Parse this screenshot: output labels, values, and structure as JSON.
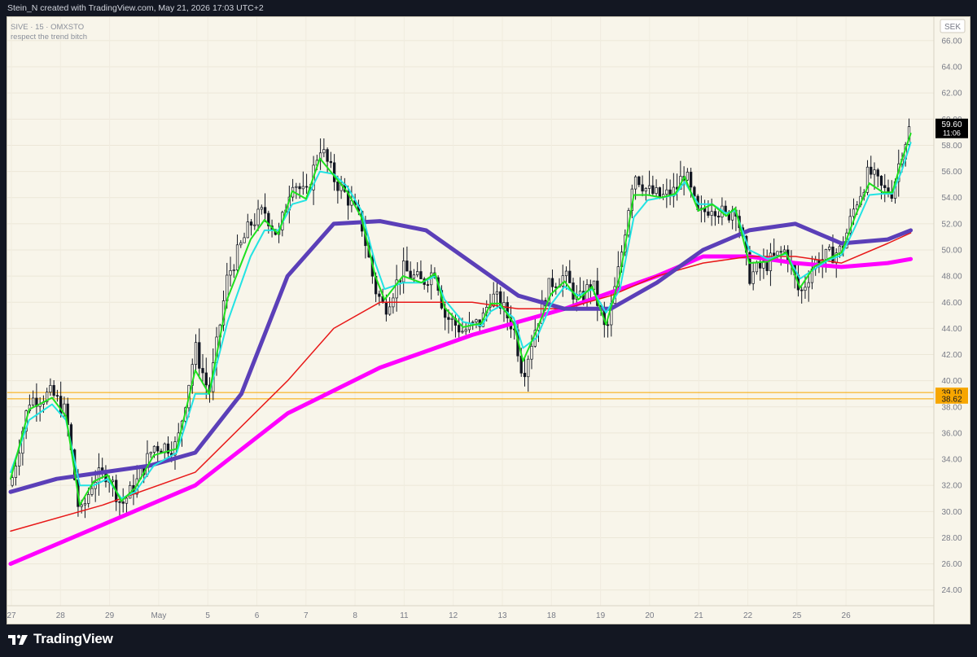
{
  "header": {
    "credit": "Stein_N created with TradingView.com, May 21, 2026 17:03 UTC+2"
  },
  "footer": {
    "brand": "TradingView"
  },
  "chart_data": {
    "type": "candlestick",
    "symbol_line": "SIVE · 15 · OMXSTO",
    "indicator_note": "respect the trend bitch",
    "currency": "SEK",
    "y_ticks": [
      "24.00",
      "26.00",
      "28.00",
      "30.00",
      "32.00",
      "34.00",
      "36.00",
      "38.00",
      "40.00",
      "42.00",
      "44.00",
      "46.00",
      "48.00",
      "50.00",
      "52.00",
      "54.00",
      "56.00",
      "58.00",
      "60.00",
      "62.00",
      "64.00",
      "66.00"
    ],
    "ylim": [
      22.8,
      67.8
    ],
    "x_ticks": [
      "27",
      "28",
      "29",
      "May",
      "5",
      "6",
      "7",
      "8",
      "11",
      "12",
      "13",
      "18",
      "19",
      "20",
      "21",
      "22",
      "25",
      "26"
    ],
    "last_price": {
      "price": "59.60",
      "countdown": "11:06",
      "value": 59.6,
      "color": "#000000"
    },
    "horizontal_levels": [
      {
        "label": "39.10",
        "value": 39.1,
        "color": "#f7a600"
      },
      {
        "label": "38.62",
        "value": 38.62,
        "color": "#f7a600"
      }
    ],
    "price_path": [
      [
        0,
        32.0
      ],
      [
        0.02,
        38.5
      ],
      [
        0.045,
        39.0
      ],
      [
        0.06,
        37.5
      ],
      [
        0.075,
        29.5
      ],
      [
        0.09,
        32.5
      ],
      [
        0.105,
        33.0
      ],
      [
        0.12,
        30.5
      ],
      [
        0.135,
        32.0
      ],
      [
        0.155,
        35.0
      ],
      [
        0.18,
        35.0
      ],
      [
        0.2,
        42.5
      ],
      [
        0.215,
        39.0
      ],
      [
        0.235,
        48.0
      ],
      [
        0.26,
        52.0
      ],
      [
        0.275,
        53.0
      ],
      [
        0.29,
        51.0
      ],
      [
        0.305,
        55.5
      ],
      [
        0.32,
        54.0
      ],
      [
        0.335,
        58.0
      ],
      [
        0.35,
        55.5
      ],
      [
        0.365,
        54.0
      ],
      [
        0.38,
        52.0
      ],
      [
        0.395,
        47.0
      ],
      [
        0.405,
        45.5
      ],
      [
        0.425,
        48.5
      ],
      [
        0.445,
        47.5
      ],
      [
        0.46,
        48.5
      ],
      [
        0.47,
        45.0
      ],
      [
        0.49,
        43.8
      ],
      [
        0.51,
        44.5
      ],
      [
        0.52,
        46.5
      ],
      [
        0.53,
        46.0
      ],
      [
        0.545,
        44.0
      ],
      [
        0.555,
        40.5
      ],
      [
        0.57,
        44.5
      ],
      [
        0.585,
        47.5
      ],
      [
        0.6,
        48.0
      ],
      [
        0.615,
        46.0
      ],
      [
        0.63,
        47.5
      ],
      [
        0.645,
        43.5
      ],
      [
        0.66,
        49.0
      ],
      [
        0.675,
        56.0
      ],
      [
        0.69,
        54.5
      ],
      [
        0.705,
        54.0
      ],
      [
        0.72,
        54.5
      ],
      [
        0.73,
        56.0
      ],
      [
        0.745,
        52.5
      ],
      [
        0.76,
        53.5
      ],
      [
        0.775,
        52.5
      ],
      [
        0.785,
        53.5
      ],
      [
        0.8,
        48.0
      ],
      [
        0.82,
        49.0
      ],
      [
        0.84,
        50.0
      ],
      [
        0.855,
        46.5
      ],
      [
        0.87,
        49.0
      ],
      [
        0.885,
        49.5
      ],
      [
        0.9,
        50.0
      ],
      [
        0.915,
        53.5
      ],
      [
        0.93,
        56.0
      ],
      [
        0.945,
        54.5
      ],
      [
        0.955,
        54.5
      ],
      [
        0.965,
        57.5
      ],
      [
        0.975,
        59.6
      ]
    ],
    "moving_averages": [
      {
        "color": "#ff00ff",
        "width": 5,
        "points": [
          [
            0,
            26.0
          ],
          [
            0.1,
            29.0
          ],
          [
            0.2,
            32.0
          ],
          [
            0.3,
            37.5
          ],
          [
            0.4,
            41.0
          ],
          [
            0.5,
            43.5
          ],
          [
            0.6,
            45.5
          ],
          [
            0.7,
            48.0
          ],
          [
            0.75,
            49.5
          ],
          [
            0.8,
            49.5
          ],
          [
            0.85,
            49.0
          ],
          [
            0.9,
            48.7
          ],
          [
            0.95,
            49.0
          ],
          [
            0.975,
            49.3
          ]
        ]
      },
      {
        "color": "#e81818",
        "width": 1.5,
        "points": [
          [
            0,
            28.5
          ],
          [
            0.1,
            30.5
          ],
          [
            0.2,
            33.0
          ],
          [
            0.3,
            40.0
          ],
          [
            0.35,
            44.0
          ],
          [
            0.4,
            46.0
          ],
          [
            0.45,
            46.0
          ],
          [
            0.5,
            46.0
          ],
          [
            0.55,
            45.5
          ],
          [
            0.6,
            45.5
          ],
          [
            0.65,
            46.5
          ],
          [
            0.7,
            48.0
          ],
          [
            0.75,
            49.0
          ],
          [
            0.8,
            49.5
          ],
          [
            0.85,
            49.5
          ],
          [
            0.9,
            49.0
          ],
          [
            0.95,
            50.5
          ],
          [
            0.975,
            51.3
          ]
        ]
      },
      {
        "color": "#5b3fb8",
        "width": 5,
        "points": [
          [
            0,
            31.5
          ],
          [
            0.05,
            32.5
          ],
          [
            0.1,
            33.0
          ],
          [
            0.15,
            33.5
          ],
          [
            0.2,
            34.5
          ],
          [
            0.25,
            39.0
          ],
          [
            0.3,
            48.0
          ],
          [
            0.35,
            52.0
          ],
          [
            0.4,
            52.2
          ],
          [
            0.45,
            51.5
          ],
          [
            0.5,
            49.0
          ],
          [
            0.55,
            46.5
          ],
          [
            0.6,
            45.5
          ],
          [
            0.65,
            45.5
          ],
          [
            0.7,
            47.5
          ],
          [
            0.75,
            50.0
          ],
          [
            0.8,
            51.5
          ],
          [
            0.85,
            52.0
          ],
          [
            0.9,
            50.5
          ],
          [
            0.95,
            50.8
          ],
          [
            0.975,
            51.5
          ]
        ]
      },
      {
        "color": "#22e3e3",
        "width": 2,
        "points": [
          [
            0,
            33.0
          ],
          [
            0.02,
            37.0
          ],
          [
            0.045,
            38.2
          ],
          [
            0.06,
            37.0
          ],
          [
            0.075,
            32.0
          ],
          [
            0.09,
            32.0
          ],
          [
            0.105,
            32.5
          ],
          [
            0.12,
            31.0
          ],
          [
            0.135,
            31.5
          ],
          [
            0.155,
            33.5
          ],
          [
            0.18,
            34.5
          ],
          [
            0.2,
            39.0
          ],
          [
            0.215,
            39.0
          ],
          [
            0.235,
            44.5
          ],
          [
            0.26,
            49.5
          ],
          [
            0.275,
            51.5
          ],
          [
            0.29,
            51.5
          ],
          [
            0.305,
            53.5
          ],
          [
            0.32,
            53.8
          ],
          [
            0.335,
            56.0
          ],
          [
            0.35,
            55.8
          ],
          [
            0.365,
            54.8
          ],
          [
            0.38,
            53.0
          ],
          [
            0.395,
            49.0
          ],
          [
            0.405,
            47.0
          ],
          [
            0.425,
            47.5
          ],
          [
            0.445,
            47.5
          ],
          [
            0.46,
            48.0
          ],
          [
            0.47,
            46.2
          ],
          [
            0.49,
            44.5
          ],
          [
            0.51,
            44.2
          ],
          [
            0.52,
            45.3
          ],
          [
            0.53,
            45.7
          ],
          [
            0.545,
            44.8
          ],
          [
            0.555,
            42.5
          ],
          [
            0.57,
            43.3
          ],
          [
            0.585,
            45.8
          ],
          [
            0.6,
            47.2
          ],
          [
            0.615,
            46.5
          ],
          [
            0.63,
            47.0
          ],
          [
            0.645,
            45.2
          ],
          [
            0.66,
            47.0
          ],
          [
            0.675,
            52.5
          ],
          [
            0.69,
            53.8
          ],
          [
            0.705,
            54.0
          ],
          [
            0.72,
            54.2
          ],
          [
            0.73,
            55.2
          ],
          [
            0.745,
            53.5
          ],
          [
            0.76,
            53.5
          ],
          [
            0.775,
            52.8
          ],
          [
            0.785,
            53.0
          ],
          [
            0.8,
            50.0
          ],
          [
            0.82,
            49.3
          ],
          [
            0.84,
            49.7
          ],
          [
            0.855,
            47.8
          ],
          [
            0.87,
            48.5
          ],
          [
            0.885,
            49.2
          ],
          [
            0.9,
            49.6
          ],
          [
            0.915,
            51.8
          ],
          [
            0.93,
            54.2
          ],
          [
            0.945,
            54.3
          ],
          [
            0.955,
            54.3
          ],
          [
            0.965,
            56.0
          ],
          [
            0.975,
            58.2
          ]
        ]
      },
      {
        "color": "#1ee01e",
        "width": 2,
        "points": [
          [
            0,
            32.5
          ],
          [
            0.02,
            37.8
          ],
          [
            0.045,
            38.7
          ],
          [
            0.06,
            37.3
          ],
          [
            0.075,
            30.5
          ],
          [
            0.09,
            32.3
          ],
          [
            0.105,
            32.8
          ],
          [
            0.12,
            30.8
          ],
          [
            0.135,
            31.8
          ],
          [
            0.155,
            34.3
          ],
          [
            0.18,
            34.8
          ],
          [
            0.2,
            40.8
          ],
          [
            0.215,
            39.0
          ],
          [
            0.235,
            46.3
          ],
          [
            0.26,
            50.8
          ],
          [
            0.275,
            52.3
          ],
          [
            0.29,
            51.2
          ],
          [
            0.305,
            54.5
          ],
          [
            0.32,
            53.9
          ],
          [
            0.335,
            57.0
          ],
          [
            0.35,
            55.7
          ],
          [
            0.365,
            54.4
          ],
          [
            0.38,
            52.5
          ],
          [
            0.395,
            48.0
          ],
          [
            0.405,
            46.2
          ],
          [
            0.425,
            48.0
          ],
          [
            0.445,
            47.5
          ],
          [
            0.46,
            48.2
          ],
          [
            0.47,
            45.6
          ],
          [
            0.49,
            44.1
          ],
          [
            0.51,
            44.4
          ],
          [
            0.52,
            45.9
          ],
          [
            0.53,
            45.9
          ],
          [
            0.545,
            44.4
          ],
          [
            0.555,
            41.5
          ],
          [
            0.57,
            43.9
          ],
          [
            0.585,
            46.6
          ],
          [
            0.6,
            47.6
          ],
          [
            0.615,
            46.2
          ],
          [
            0.63,
            47.2
          ],
          [
            0.645,
            44.3
          ],
          [
            0.66,
            48.0
          ],
          [
            0.675,
            54.2
          ],
          [
            0.69,
            54.2
          ],
          [
            0.705,
            54.0
          ],
          [
            0.72,
            54.3
          ],
          [
            0.73,
            55.6
          ],
          [
            0.745,
            53.0
          ],
          [
            0.76,
            53.5
          ],
          [
            0.775,
            52.6
          ],
          [
            0.785,
            53.2
          ],
          [
            0.8,
            49.0
          ],
          [
            0.82,
            49.1
          ],
          [
            0.84,
            49.8
          ],
          [
            0.855,
            47.1
          ],
          [
            0.87,
            48.7
          ],
          [
            0.885,
            49.3
          ],
          [
            0.9,
            49.8
          ],
          [
            0.915,
            52.6
          ],
          [
            0.93,
            55.1
          ],
          [
            0.945,
            54.4
          ],
          [
            0.955,
            54.4
          ],
          [
            0.965,
            56.8
          ],
          [
            0.975,
            58.9
          ]
        ]
      }
    ]
  }
}
